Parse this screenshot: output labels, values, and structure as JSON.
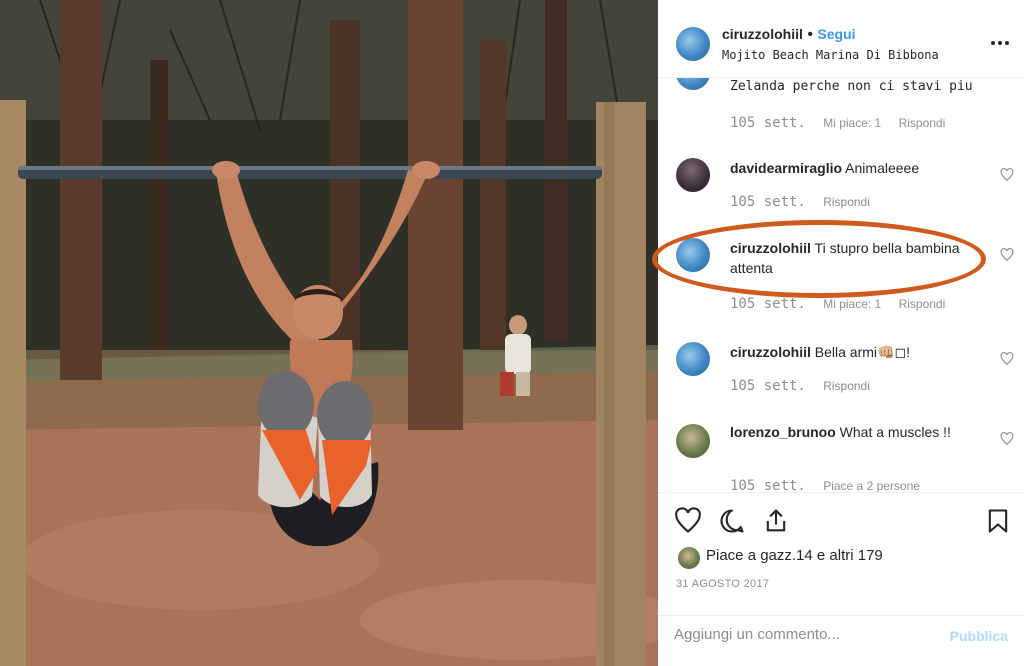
{
  "post": {
    "username": "ciruzzolohiil",
    "separator": "•",
    "follow_label": "Segui",
    "location": "Mojito Beach Marina Di Bibbona",
    "more_label": "•••"
  },
  "comments": [
    {
      "text": "Zelanda perche non ci stavi piu",
      "time": "105 sett.",
      "likes": "Mi piace: 1",
      "reply": "Rispondi"
    },
    {
      "user": "davidearmiraglio",
      "text": "Animaleeee",
      "time": "105 sett.",
      "reply": "Rispondi"
    },
    {
      "user": "ciruzzolohiil",
      "text": "Ti stupro bella bambina attenta",
      "time": "105 sett.",
      "likes": "Mi piace: 1",
      "reply": "Rispondi"
    },
    {
      "user": "ciruzzolohiil",
      "text": "Bella armi👊🏼◻!",
      "time": "105 sett.",
      "reply": "Rispondi"
    },
    {
      "user": "lorenzo_brunoo",
      "text": "What a muscles !!",
      "time": "105 sett.",
      "likes": "Piace a 2 persone"
    }
  ],
  "actions": {
    "likes_text": "Piace a gazz.14 e altri 179",
    "date": "31 AGOSTO 2017",
    "comment_placeholder": "Aggiungi un commento...",
    "publish_label": "Pubblica"
  },
  "icons": [
    "heart-icon",
    "comment-icon",
    "share-icon",
    "bookmark-icon",
    "more-options-icon"
  ],
  "colors": {
    "accent": "#3897f0",
    "highlight": "#d05a1c",
    "muted": "#8e8e8e"
  }
}
